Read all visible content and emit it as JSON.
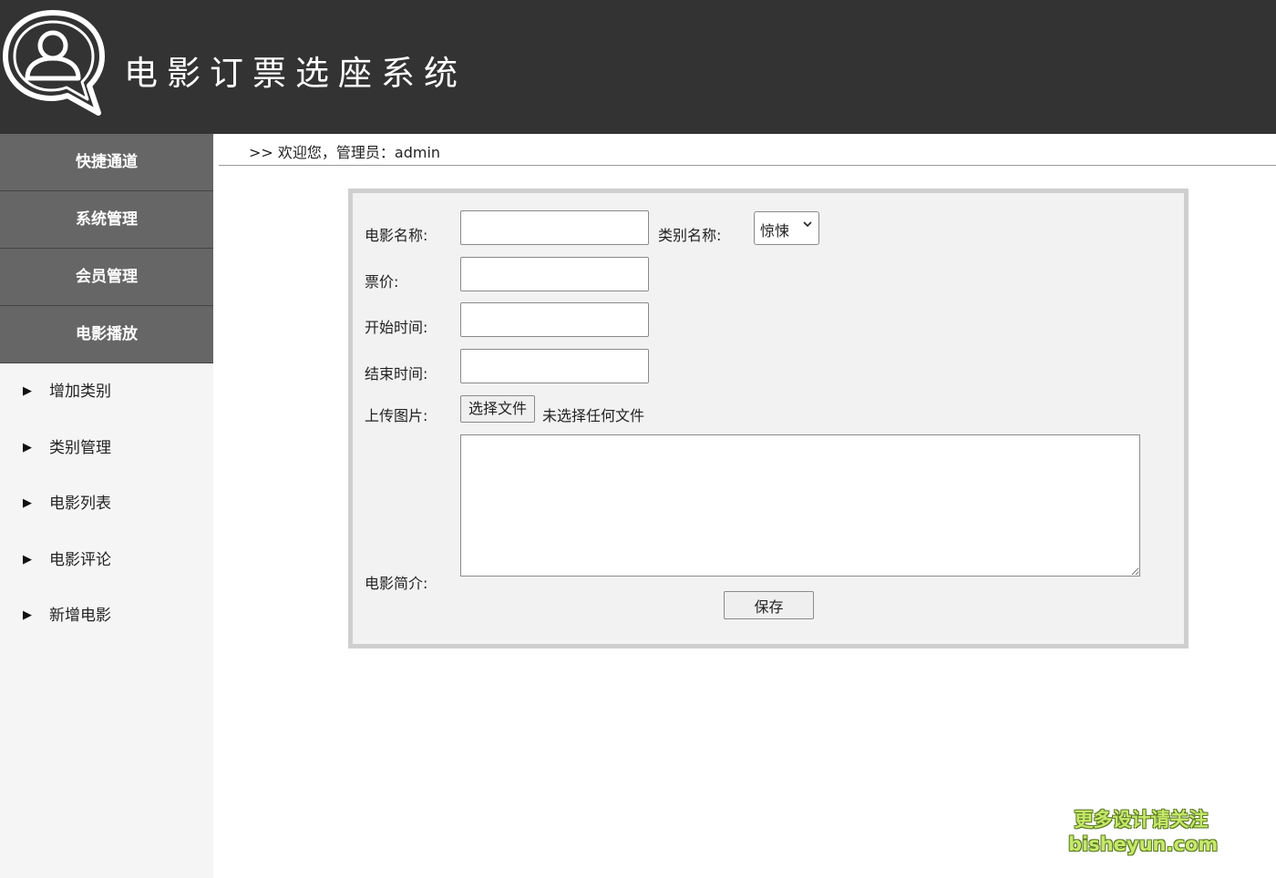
{
  "header": {
    "title": "电影订票选座系统",
    "logo_icon": "user-chat-icon"
  },
  "sidebar": {
    "menu": [
      {
        "label": "快捷通道"
      },
      {
        "label": "系统管理"
      },
      {
        "label": "会员管理"
      },
      {
        "label": "电影播放"
      }
    ],
    "sub_items": [
      {
        "label": "增加类别",
        "icon": "triangle-right-icon"
      },
      {
        "label": "类别管理",
        "icon": "triangle-right-icon"
      },
      {
        "label": "电影列表",
        "icon": "triangle-right-icon"
      },
      {
        "label": "电影评论",
        "icon": "triangle-right-icon"
      },
      {
        "label": "新增电影",
        "icon": "triangle-right-icon"
      }
    ]
  },
  "breadcrumb": {
    "text": ">> 欢迎您，管理员：admin"
  },
  "form": {
    "movie_name_label": "电影名称:",
    "movie_name_value": "",
    "category_label": "类别名称:",
    "category_selected": "惊悚",
    "price_label": "票价:",
    "price_value": "",
    "start_time_label": "开始时间:",
    "start_time_value": "",
    "end_time_label": "结束时间:",
    "end_time_value": "",
    "upload_label": "上传图片:",
    "file_button": "选择文件",
    "file_status": "未选择任何文件",
    "intro_label": "电影简介:",
    "intro_value": "",
    "save_button": "保存"
  },
  "watermark": {
    "line1": "更多设计请关注",
    "line2": "bisheyun.com"
  },
  "colors": {
    "header_bg": "#333333",
    "menu_bg": "#666666",
    "panel_bg": "#f2f2f2",
    "panel_border": "#cfcfcf",
    "watermark": "#c6e86b"
  }
}
